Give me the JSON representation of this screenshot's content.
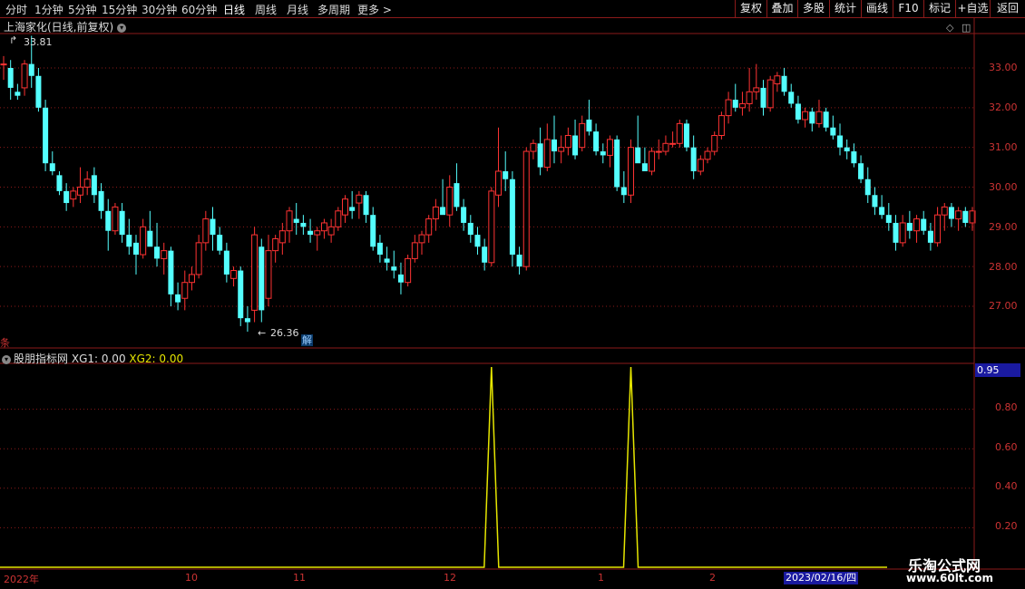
{
  "toolbar": {
    "periods": [
      "分时",
      "1分钟",
      "5分钟",
      "15分钟",
      "30分钟",
      "60分钟",
      "日线",
      "周线",
      "月线",
      "多周期",
      "更多 >"
    ],
    "active_period": "日线",
    "right_buttons": [
      "复权",
      "叠加",
      "多股",
      "统计",
      "画线",
      "F10",
      "标记",
      "+自选",
      "返回"
    ]
  },
  "main_panel": {
    "title": "上海家化(日线,前复权)",
    "max_label": "33.81",
    "min_label": "26.36",
    "jie_label": "解",
    "left_marker": "条"
  },
  "indicator_panel": {
    "title": "股朋指标网",
    "xg1_text": "XG1: 0.00",
    "xg2_text": "XG2: 0.00",
    "cursor_value": "0.95"
  },
  "date_axis": {
    "labels": [
      "2022年",
      "10",
      "11",
      "12",
      "1",
      "2"
    ],
    "cursor_date": "2023/02/16/四"
  },
  "watermark": {
    "line1": "乐淘公式网",
    "line2": "www.60lt.com"
  },
  "colors": {
    "up": "#ff3333",
    "down": "#54ffff",
    "grid": "#8b1a1a",
    "signal": "#e6e600",
    "axis_text": "#cc3333"
  },
  "chart_data": [
    {
      "type": "candlestick",
      "title": "上海家化(日线,前复权)",
      "y_ticks": [
        27.0,
        28.0,
        29.0,
        30.0,
        31.0,
        32.0,
        33.0
      ],
      "ylim": [
        26.0,
        34.0
      ],
      "grid": true,
      "annotations": [
        {
          "label": "33.81"
        },
        {
          "label": "26.36"
        }
      ],
      "x_labels": [
        "2022年",
        "10",
        "11",
        "12",
        "1",
        "2"
      ],
      "ohlc": [
        [
          33.1,
          33.3,
          32.7,
          33.1
        ],
        [
          33.0,
          33.2,
          32.2,
          32.5
        ],
        [
          32.4,
          32.6,
          32.2,
          32.3
        ],
        [
          32.5,
          33.2,
          32.3,
          33.1
        ],
        [
          33.1,
          33.81,
          32.5,
          32.8
        ],
        [
          32.8,
          33.0,
          31.9,
          32.0
        ],
        [
          32.0,
          32.2,
          30.4,
          30.6
        ],
        [
          30.6,
          30.9,
          30.3,
          30.4
        ],
        [
          30.3,
          30.4,
          29.8,
          29.9
        ],
        [
          29.9,
          30.1,
          29.4,
          29.6
        ],
        [
          29.7,
          30.0,
          29.5,
          29.9
        ],
        [
          29.8,
          30.5,
          29.6,
          30.0
        ],
        [
          30.0,
          30.4,
          29.8,
          30.2
        ],
        [
          30.3,
          30.5,
          29.6,
          29.8
        ],
        [
          29.9,
          30.1,
          29.2,
          29.4
        ],
        [
          29.4,
          29.7,
          28.4,
          28.9
        ],
        [
          28.9,
          29.6,
          28.8,
          29.5
        ],
        [
          29.4,
          29.6,
          28.6,
          28.8
        ],
        [
          28.8,
          29.2,
          28.3,
          28.5
        ],
        [
          28.6,
          28.8,
          27.8,
          28.3
        ],
        [
          28.3,
          29.2,
          28.2,
          29.0
        ],
        [
          28.9,
          29.4,
          28.6,
          28.5
        ],
        [
          28.5,
          29.1,
          28.0,
          28.2
        ],
        [
          28.2,
          28.6,
          27.8,
          28.4
        ],
        [
          28.4,
          28.5,
          27.0,
          27.3
        ],
        [
          27.3,
          27.6,
          26.9,
          27.1
        ],
        [
          27.2,
          27.9,
          26.9,
          27.6
        ],
        [
          27.6,
          28.0,
          27.4,
          27.8
        ],
        [
          27.8,
          28.8,
          27.7,
          28.6
        ],
        [
          28.6,
          29.4,
          28.4,
          29.2
        ],
        [
          29.2,
          29.5,
          28.4,
          28.8
        ],
        [
          28.8,
          29.0,
          28.3,
          28.4
        ],
        [
          28.4,
          28.6,
          27.6,
          27.8
        ],
        [
          27.7,
          28.0,
          27.5,
          27.9
        ],
        [
          27.9,
          28.0,
          26.5,
          26.7
        ],
        [
          26.7,
          27.0,
          26.36,
          26.6
        ],
        [
          26.9,
          29.0,
          26.6,
          28.8
        ],
        [
          28.5,
          28.7,
          26.6,
          26.9
        ],
        [
          27.2,
          28.8,
          27.0,
          28.4
        ],
        [
          28.4,
          28.8,
          28.1,
          28.7
        ],
        [
          28.6,
          29.1,
          28.3,
          28.9
        ],
        [
          28.9,
          29.5,
          28.6,
          29.4
        ],
        [
          29.2,
          29.6,
          28.8,
          29.1
        ],
        [
          29.1,
          29.3,
          28.8,
          29.0
        ],
        [
          28.9,
          29.2,
          28.6,
          28.8
        ],
        [
          28.8,
          29.0,
          28.4,
          28.9
        ],
        [
          28.9,
          29.2,
          28.7,
          29.1
        ],
        [
          28.8,
          29.2,
          28.6,
          29.0
        ],
        [
          29.0,
          29.5,
          28.9,
          29.4
        ],
        [
          29.3,
          29.8,
          29.1,
          29.7
        ],
        [
          29.5,
          29.9,
          29.2,
          29.4
        ],
        [
          29.6,
          29.9,
          29.2,
          29.8
        ],
        [
          29.8,
          29.9,
          29.1,
          29.3
        ],
        [
          29.3,
          29.5,
          28.4,
          28.5
        ],
        [
          28.6,
          28.8,
          28.1,
          28.3
        ],
        [
          28.2,
          28.5,
          27.9,
          28.1
        ],
        [
          28.0,
          28.4,
          27.7,
          27.9
        ],
        [
          27.8,
          28.1,
          27.3,
          27.6
        ],
        [
          27.6,
          28.3,
          27.5,
          28.2
        ],
        [
          28.2,
          28.8,
          28.1,
          28.6
        ],
        [
          28.6,
          28.9,
          28.3,
          28.8
        ],
        [
          28.8,
          29.3,
          28.6,
          29.2
        ],
        [
          29.2,
          29.7,
          28.9,
          29.5
        ],
        [
          29.5,
          30.2,
          29.4,
          29.3
        ],
        [
          29.3,
          30.3,
          29.0,
          30.0
        ],
        [
          30.1,
          30.6,
          29.4,
          29.5
        ],
        [
          29.5,
          29.7,
          28.9,
          29.1
        ],
        [
          29.1,
          29.3,
          28.6,
          28.8
        ],
        [
          28.8,
          29.0,
          28.3,
          28.5
        ],
        [
          28.5,
          28.7,
          27.9,
          28.1
        ],
        [
          28.1,
          30.0,
          28.0,
          29.9
        ],
        [
          29.8,
          31.5,
          29.5,
          30.4
        ],
        [
          30.4,
          30.9,
          29.9,
          30.2
        ],
        [
          30.2,
          30.4,
          28.0,
          28.3
        ],
        [
          28.3,
          28.5,
          27.8,
          28.0
        ],
        [
          28.0,
          31.0,
          27.9,
          30.9
        ],
        [
          30.9,
          31.2,
          30.7,
          31.1
        ],
        [
          31.1,
          31.5,
          30.3,
          30.5
        ],
        [
          30.5,
          31.6,
          30.4,
          31.2
        ],
        [
          31.2,
          31.8,
          30.6,
          30.9
        ],
        [
          30.9,
          31.3,
          30.6,
          31.0
        ],
        [
          31.0,
          31.5,
          30.8,
          31.3
        ],
        [
          31.3,
          31.7,
          30.7,
          30.8
        ],
        [
          31.0,
          31.8,
          30.9,
          31.6
        ],
        [
          31.7,
          32.2,
          31.3,
          31.4
        ],
        [
          31.4,
          31.6,
          30.8,
          30.9
        ],
        [
          30.9,
          31.1,
          30.6,
          30.8
        ],
        [
          30.8,
          31.3,
          30.5,
          31.2
        ],
        [
          31.2,
          31.3,
          29.9,
          30.0
        ],
        [
          30.0,
          30.4,
          29.6,
          29.8
        ],
        [
          29.8,
          31.2,
          29.6,
          31.0
        ],
        [
          31.0,
          31.8,
          30.8,
          30.6
        ],
        [
          30.6,
          31.0,
          30.5,
          30.4
        ],
        [
          30.4,
          31.0,
          30.3,
          30.9
        ],
        [
          30.9,
          31.2,
          30.7,
          30.9
        ],
        [
          30.9,
          31.3,
          30.8,
          31.1
        ],
        [
          31.1,
          31.4,
          31.0,
          31.1
        ],
        [
          31.1,
          31.7,
          31.0,
          31.6
        ],
        [
          31.6,
          31.7,
          30.9,
          31.0
        ],
        [
          31.0,
          31.3,
          30.2,
          30.4
        ],
        [
          30.4,
          30.8,
          30.3,
          30.7
        ],
        [
          30.7,
          31.0,
          30.6,
          30.9
        ],
        [
          30.9,
          31.4,
          30.8,
          31.3
        ],
        [
          31.3,
          31.9,
          31.2,
          31.8
        ],
        [
          31.8,
          32.4,
          31.6,
          32.2
        ],
        [
          32.2,
          32.6,
          31.9,
          32.0
        ],
        [
          32.0,
          32.4,
          31.8,
          32.1
        ],
        [
          32.1,
          33.0,
          31.9,
          32.4
        ],
        [
          32.4,
          33.1,
          32.2,
          32.5
        ],
        [
          32.5,
          32.7,
          31.8,
          32.0
        ],
        [
          32.0,
          32.8,
          31.9,
          32.7
        ],
        [
          32.6,
          32.9,
          32.4,
          32.8
        ],
        [
          32.8,
          33.0,
          32.3,
          32.4
        ],
        [
          32.4,
          32.6,
          32.0,
          32.1
        ],
        [
          32.1,
          32.3,
          31.6,
          31.7
        ],
        [
          31.7,
          32.0,
          31.5,
          31.9
        ],
        [
          31.9,
          32.0,
          31.4,
          31.6
        ],
        [
          31.6,
          32.2,
          31.5,
          31.9
        ],
        [
          31.9,
          32.0,
          31.4,
          31.5
        ],
        [
          31.5,
          31.8,
          31.2,
          31.3
        ],
        [
          31.3,
          31.6,
          30.8,
          31.0
        ],
        [
          31.0,
          31.2,
          30.7,
          30.9
        ],
        [
          30.9,
          31.1,
          30.5,
          30.6
        ],
        [
          30.6,
          30.8,
          30.1,
          30.2
        ],
        [
          30.2,
          30.5,
          29.6,
          29.8
        ],
        [
          29.8,
          30.0,
          29.3,
          29.5
        ],
        [
          29.5,
          29.8,
          29.2,
          29.3
        ],
        [
          29.3,
          29.6,
          28.9,
          29.1
        ],
        [
          29.1,
          29.3,
          28.4,
          28.6
        ],
        [
          28.6,
          29.3,
          28.5,
          29.1
        ],
        [
          29.1,
          29.4,
          28.7,
          28.9
        ],
        [
          28.9,
          29.3,
          28.6,
          29.2
        ],
        [
          29.2,
          29.4,
          28.8,
          28.9
        ],
        [
          28.9,
          29.1,
          28.4,
          28.6
        ],
        [
          28.6,
          29.5,
          28.5,
          29.3
        ],
        [
          29.3,
          29.6,
          28.9,
          29.5
        ],
        [
          29.5,
          29.6,
          29.0,
          29.2
        ],
        [
          29.2,
          29.5,
          28.9,
          29.4
        ],
        [
          29.4,
          29.5,
          29.0,
          29.1
        ],
        [
          29.1,
          29.5,
          28.9,
          29.4
        ]
      ]
    },
    {
      "type": "line",
      "title": "股朋指标网",
      "series": [
        {
          "name": "XG1",
          "value_now": 0.0
        },
        {
          "name": "XG2",
          "value_now": 0.0
        }
      ],
      "y_ticks": [
        0.2,
        0.4,
        0.6,
        0.8
      ],
      "ylim": [
        0.0,
        1.0
      ],
      "spikes": [
        {
          "index": 70,
          "value": 1.0
        },
        {
          "index": 90,
          "value": 1.0
        }
      ],
      "baseline": 0.0
    }
  ]
}
